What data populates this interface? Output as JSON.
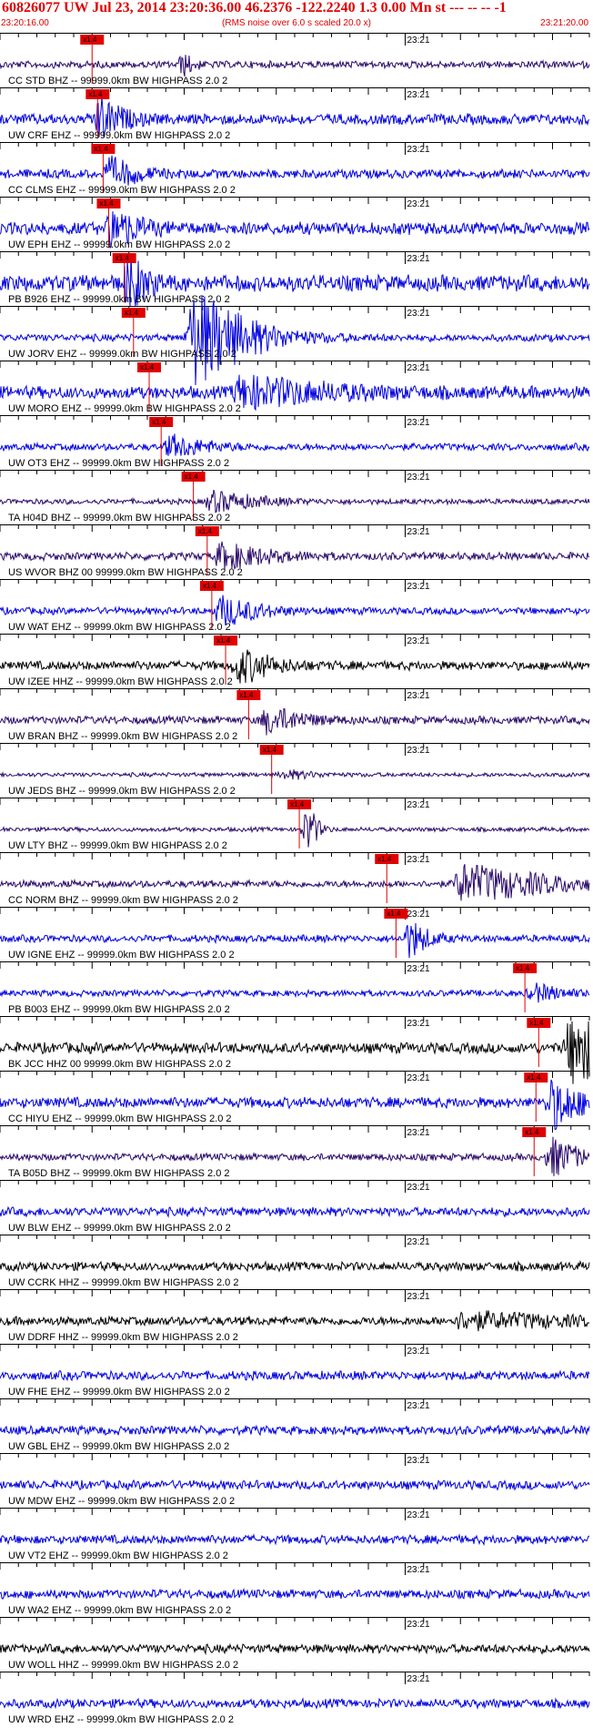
{
  "header": {
    "title": "60826077 UW Jul 23, 2014 23:20:36.00   46.2376 -122.2240  1.3 0.00 Mn st --- -- --  -1",
    "start_time": "23:20:16.00",
    "note": "(RMS noise over 6.0 s scaled 20.0 x)",
    "end_time": "23:21:20.00"
  },
  "colors": {
    "title": "#e00000",
    "pick": "#e00000",
    "trace_blue": "#0000e0",
    "trace_black": "#000000",
    "trace_navy": "#2a0a6a",
    "axis": "#000000"
  },
  "chart_data": {
    "type": "line",
    "x_start": "23:20:16.00",
    "x_end": "23:21:20.00",
    "minute_label": "23:21",
    "pick_label": "x1.4",
    "traces": [
      {
        "label": "CC STD BHZ -- 99999.0km BW  HIGHPASS  2.0  2",
        "color": "#2a0a6a",
        "pick_s": 10.0,
        "amp": 0.2,
        "burst_s": 20.0,
        "burst_amp": 0.5,
        "burst_w": 1.0
      },
      {
        "label": "UW CRF EHZ -- 99999.0km BW  HIGHPASS  2.0  2",
        "color": "#0000e0",
        "pick_s": 10.6,
        "amp": 0.3,
        "burst_s": 10.8,
        "burst_amp": 1.0,
        "burst_w": 2.5
      },
      {
        "label": "CC CLMS EHZ -- 99999.0km BW  HIGHPASS  2.0  2",
        "color": "#0000e0",
        "pick_s": 11.2,
        "amp": 0.25,
        "burst_s": 12.0,
        "burst_amp": 0.7,
        "burst_w": 3.0
      },
      {
        "label": "UW EPH EHZ -- 99999.0km BW  HIGHPASS  2.0  2",
        "color": "#0000e0",
        "pick_s": 11.8,
        "amp": 0.35,
        "burst_s": 12.2,
        "burst_amp": 0.9,
        "burst_w": 3.0
      },
      {
        "label": "PB B926 EHZ -- 99999.0km BW  HIGHPASS  2.0  2",
        "color": "#0000e0",
        "pick_s": 13.5,
        "amp": 0.45,
        "burst_s": 14.0,
        "burst_amp": 1.2,
        "burst_w": 2.0
      },
      {
        "label": "UW JORV EHZ -- 99999.0km BW  HIGHPASS  2.0  2",
        "color": "#0000e0",
        "pick_s": 14.5,
        "amp": 0.2,
        "burst_s": 21.0,
        "burst_amp": 2.4,
        "burst_w": 6.0
      },
      {
        "label": "UW MORO EHZ -- 99999.0km BW  HIGHPASS  2.0  2",
        "color": "#0000e0",
        "pick_s": 16.2,
        "amp": 0.35,
        "burst_s": 26.0,
        "burst_amp": 0.7,
        "burst_w": 10.0
      },
      {
        "label": "UW OT3 EHZ -- 99999.0km BW  HIGHPASS  2.0  2",
        "color": "#0000e0",
        "pick_s": 17.5,
        "amp": 0.2,
        "burst_s": 18.5,
        "burst_amp": 0.5,
        "burst_w": 4.0
      },
      {
        "label": "TA H04D BHZ -- 99999.0km BW  HIGHPASS  2.0  2",
        "color": "#2a0a6a",
        "pick_s": 21.0,
        "amp": 0.15,
        "burst_s": 23.0,
        "burst_amp": 0.5,
        "burst_w": 5.0
      },
      {
        "label": "US WVOR BHZ 00 99999.0km BW  HIGHPASS  2.0  2",
        "color": "#2a0a6a",
        "pick_s": 22.5,
        "amp": 0.22,
        "burst_s": 24.0,
        "burst_amp": 0.6,
        "burst_w": 5.0
      },
      {
        "label": "UW WAT EHZ -- 99999.0km BW  HIGHPASS  2.0  2",
        "color": "#0000e0",
        "pick_s": 23.0,
        "amp": 0.2,
        "burst_s": 24.0,
        "burst_amp": 0.7,
        "burst_w": 4.0
      },
      {
        "label": "UW IZEE HHZ -- 99999.0km BW  HIGHPASS  2.0  2",
        "color": "#000000",
        "pick_s": 24.5,
        "amp": 0.25,
        "burst_s": 26.0,
        "burst_amp": 0.8,
        "burst_w": 3.5
      },
      {
        "label": "UW BRAN BHZ -- 99999.0km BW  HIGHPASS  2.0  2",
        "color": "#2a0a6a",
        "pick_s": 27.0,
        "amp": 0.22,
        "burst_s": 29.0,
        "burst_amp": 0.6,
        "burst_w": 4.0
      },
      {
        "label": "UW JEDS BHZ -- 99999.0km BW  HIGHPASS  2.0  2",
        "color": "#2a0a6a",
        "pick_s": 29.5,
        "amp": 0.12,
        "burst_s": 31.0,
        "burst_amp": 0.2,
        "burst_w": 3.0
      },
      {
        "label": "UW LTY BHZ -- 99999.0km BW  HIGHPASS  2.0  2",
        "color": "#2a0a6a",
        "pick_s": 32.5,
        "amp": 0.12,
        "burst_s": 33.5,
        "burst_amp": 1.2,
        "burst_w": 1.0
      },
      {
        "label": "CC NORM BHZ -- 99999.0km BW  HIGHPASS  2.0  2",
        "color": "#2a0a6a",
        "pick_s": 42.0,
        "amp": 0.2,
        "burst_s": 50.0,
        "burst_amp": 0.9,
        "burst_w": 10.0
      },
      {
        "label": "UW IGNE EHZ -- 99999.0km BW  HIGHPASS  2.0  2",
        "color": "#0000e0",
        "pick_s": 43.0,
        "amp": 0.2,
        "burst_s": 44.5,
        "burst_amp": 0.9,
        "burst_w": 2.0
      },
      {
        "label": "PB B003 EHZ -- 99999.0km BW  HIGHPASS  2.0  2",
        "color": "#0000e0",
        "pick_s": 57.0,
        "amp": 0.18,
        "burst_s": 58.0,
        "burst_amp": 0.4,
        "burst_w": 3.0
      },
      {
        "label": "BK JCC HHZ 00 99999.0km BW  HIGHPASS  2.0  2",
        "color": "#000000",
        "pick_s": 58.5,
        "amp": 0.3,
        "burst_s": 62.0,
        "burst_amp": 1.6,
        "burst_w": 8.0
      },
      {
        "label": "CC HIYU EHZ -- 99999.0km BW  HIGHPASS  2.0  2",
        "color": "#0000e0",
        "pick_s": 58.2,
        "amp": 0.3,
        "burst_s": 60.0,
        "burst_amp": 1.2,
        "burst_w": 3.0
      },
      {
        "label": "TA B05D BHZ -- 99999.0km BW  HIGHPASS  2.0  2",
        "color": "#2a0a6a",
        "pick_s": 58.0,
        "amp": 0.2,
        "burst_s": 60.0,
        "burst_amp": 0.9,
        "burst_w": 3.0
      },
      {
        "label": "UW BLW EHZ -- 99999.0km BW  HIGHPASS  2.0  2",
        "color": "#0000e0",
        "pick_s": null,
        "amp": 0.25,
        "burst_s": null,
        "burst_amp": 0,
        "burst_w": 0
      },
      {
        "label": "UW CCRK HHZ -- 99999.0km BW  HIGHPASS  2.0  2",
        "color": "#000000",
        "pick_s": null,
        "amp": 0.25,
        "burst_s": null,
        "burst_amp": 0,
        "burst_w": 0
      },
      {
        "label": "UW DDRF HHZ -- 99999.0km BW  HIGHPASS  2.0  2",
        "color": "#000000",
        "pick_s": null,
        "amp": 0.25,
        "burst_s": 50.0,
        "burst_amp": 0.35,
        "burst_w": 12.0
      },
      {
        "label": "UW FHE EHZ -- 99999.0km BW  HIGHPASS  2.0  2",
        "color": "#0000e0",
        "pick_s": null,
        "amp": 0.25,
        "burst_s": null,
        "burst_amp": 0,
        "burst_w": 0
      },
      {
        "label": "UW GBL EHZ -- 99999.0km BW  HIGHPASS  2.0  2",
        "color": "#0000e0",
        "pick_s": null,
        "amp": 0.25,
        "burst_s": null,
        "burst_amp": 0,
        "burst_w": 0
      },
      {
        "label": "UW MDW EHZ -- 99999.0km BW  HIGHPASS  2.0  2",
        "color": "#0000e0",
        "pick_s": null,
        "amp": 0.25,
        "burst_s": null,
        "burst_amp": 0,
        "burst_w": 0
      },
      {
        "label": "UW VT2 EHZ -- 99999.0km BW  HIGHPASS  2.0  2",
        "color": "#0000e0",
        "pick_s": null,
        "amp": 0.25,
        "burst_s": null,
        "burst_amp": 0,
        "burst_w": 0
      },
      {
        "label": "UW WA2 EHZ -- 99999.0km BW  HIGHPASS  2.0  2",
        "color": "#0000e0",
        "pick_s": null,
        "amp": 0.25,
        "burst_s": null,
        "burst_amp": 0,
        "burst_w": 0
      },
      {
        "label": "UW WOLL HHZ -- 99999.0km BW  HIGHPASS  2.0  2",
        "color": "#000000",
        "pick_s": null,
        "amp": 0.25,
        "burst_s": null,
        "burst_amp": 0,
        "burst_w": 0
      },
      {
        "label": "UW WRD EHZ -- 99999.0km BW  HIGHPASS  2.0  2",
        "color": "#0000e0",
        "pick_s": null,
        "amp": 0.25,
        "burst_s": null,
        "burst_amp": 0,
        "burst_w": 0
      }
    ]
  }
}
